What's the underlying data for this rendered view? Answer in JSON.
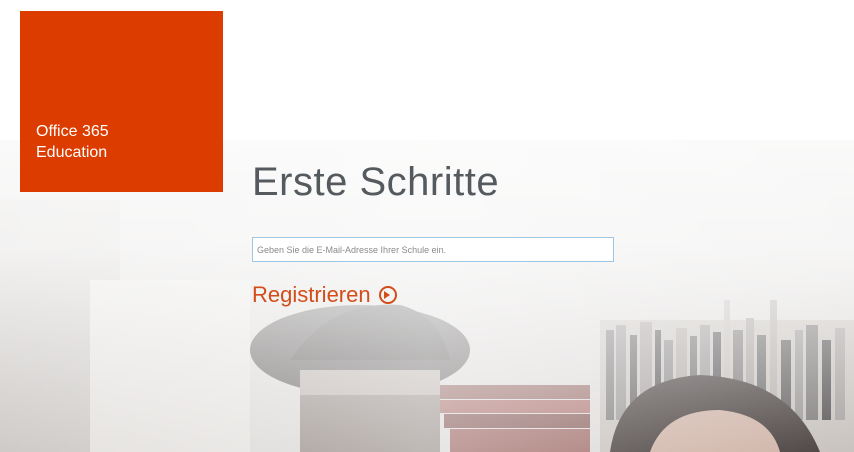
{
  "brand": {
    "line1": "Office 365",
    "line2": "Education",
    "tile_color": "#dc3c00"
  },
  "main": {
    "heading": "Erste Schritte",
    "email_placeholder": "Geben Sie die E-Mail-Adresse Ihrer Schule ein.",
    "email_value": "",
    "register_label": "Registrieren",
    "register_icon": "circle-arrow-right-icon",
    "accent_color": "#d24d1a"
  },
  "background": {
    "description_icon": "library-photo"
  }
}
